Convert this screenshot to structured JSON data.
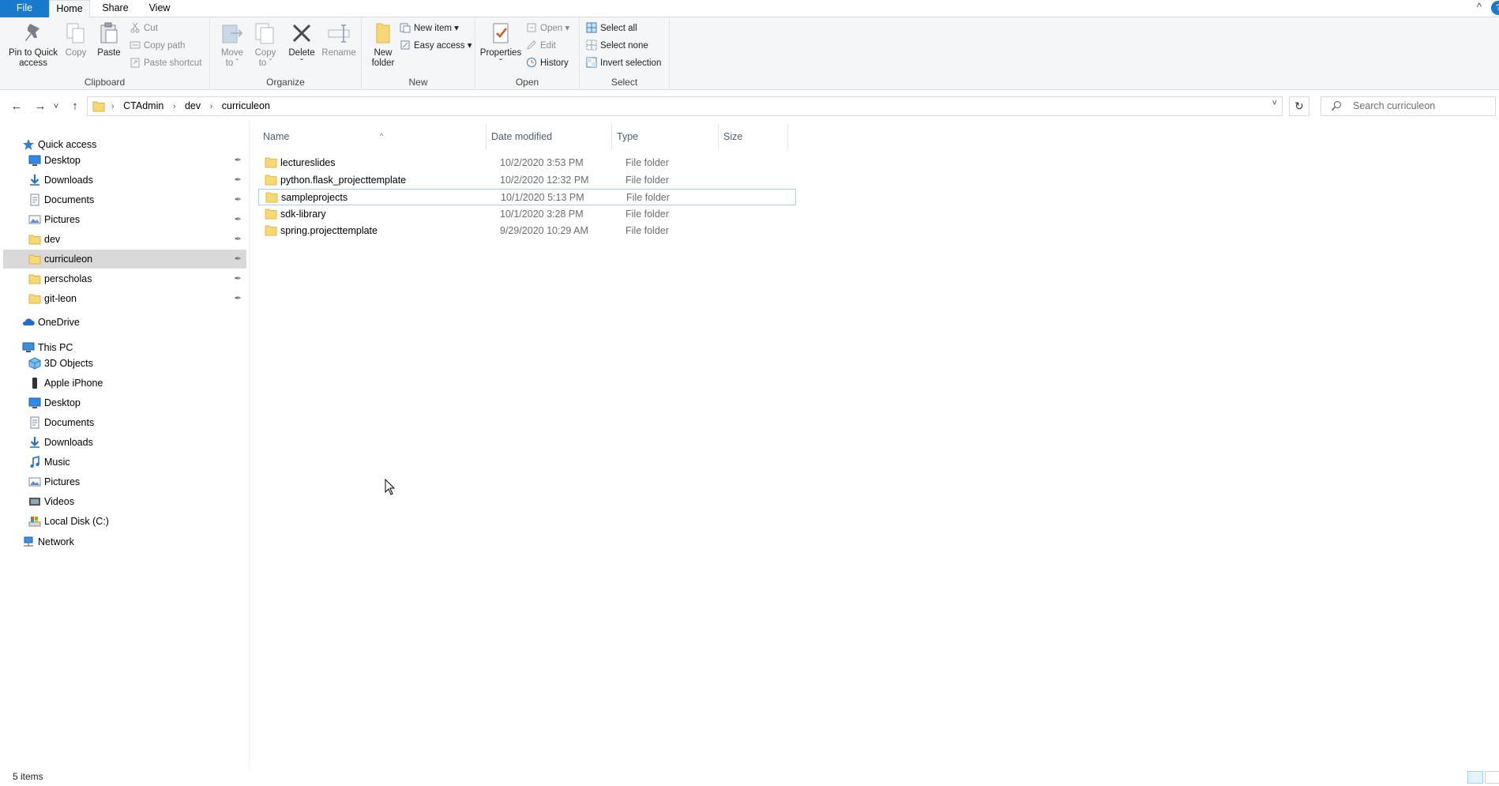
{
  "ribbon_tabs": {
    "file": "File",
    "home": "Home",
    "share": "Share",
    "view": "View"
  },
  "window": {
    "collapse_glyph": "^",
    "help_glyph": "?"
  },
  "ribbon": {
    "clipboard": {
      "label": "Clipboard",
      "pin_line1": "Pin to Quick",
      "pin_line2": "access",
      "copy": "Copy",
      "paste": "Paste",
      "cut": "Cut",
      "copy_path": "Copy path",
      "paste_shortcut": "Paste shortcut"
    },
    "organize": {
      "label": "Organize",
      "move_line1": "Move",
      "move_line2": "to ˇ",
      "copyto_line1": "Copy",
      "copyto_line2": "to ˇ",
      "delete": "Delete",
      "delete_arrow": "ˇ",
      "rename": "Rename"
    },
    "new": {
      "label": "New",
      "folder_line1": "New",
      "folder_line2": "folder",
      "new_item": "New item ▾",
      "easy_access": "Easy access ▾"
    },
    "open": {
      "label": "Open",
      "properties": "Properties",
      "properties_arrow": "ˇ",
      "open": "Open ▾",
      "edit": "Edit",
      "history": "History"
    },
    "select": {
      "label": "Select",
      "select_all": "Select all",
      "select_none": "Select none",
      "invert": "Invert selection"
    }
  },
  "address": {
    "back": "←",
    "forward": "→",
    "recent": "˅",
    "up": "↑",
    "crumbs": [
      "CTAdmin",
      "dev",
      "curriculeon"
    ],
    "sep": "›",
    "dropdown": "˅",
    "refresh": "↻",
    "search_placeholder": "Search curriculeon"
  },
  "nav": {
    "quick_access": "Quick access",
    "qa_items": [
      {
        "label": "Desktop",
        "icon": "desktop-icon"
      },
      {
        "label": "Downloads",
        "icon": "downloads-icon"
      },
      {
        "label": "Documents",
        "icon": "documents-icon"
      },
      {
        "label": "Pictures",
        "icon": "pictures-icon"
      },
      {
        "label": "dev",
        "icon": "folder-icon"
      },
      {
        "label": "curriculeon",
        "icon": "folder-icon"
      },
      {
        "label": "perscholas",
        "icon": "folder-icon"
      },
      {
        "label": "git-leon",
        "icon": "folder-icon"
      }
    ],
    "onedrive": "OneDrive",
    "this_pc": "This PC",
    "pc_items": [
      {
        "label": "3D Objects",
        "icon": "3d-objects-icon"
      },
      {
        "label": "Apple iPhone",
        "icon": "phone-icon"
      },
      {
        "label": "Desktop",
        "icon": "desktop-icon"
      },
      {
        "label": "Documents",
        "icon": "documents-icon"
      },
      {
        "label": "Downloads",
        "icon": "downloads-icon"
      },
      {
        "label": "Music",
        "icon": "music-icon"
      },
      {
        "label": "Pictures",
        "icon": "pictures-icon"
      },
      {
        "label": "Videos",
        "icon": "videos-icon"
      },
      {
        "label": "Local Disk (C:)",
        "icon": "drive-icon"
      }
    ],
    "network": "Network",
    "pin_glyph": "📌"
  },
  "columns": {
    "name": "Name",
    "date": "Date modified",
    "type": "Type",
    "size": "Size",
    "sort_glyph": "^"
  },
  "files": [
    {
      "name": "lectureslides",
      "date": "10/2/2020 3:53 PM",
      "type": "File folder"
    },
    {
      "name": "python.flask_projecttemplate",
      "date": "10/2/2020 12:32 PM",
      "type": "File folder"
    },
    {
      "name": "sampleprojects",
      "date": "10/1/2020 5:13 PM",
      "type": "File folder"
    },
    {
      "name": "sdk-library",
      "date": "10/1/2020 3:28 PM",
      "type": "File folder"
    },
    {
      "name": "spring.projecttemplate",
      "date": "9/29/2020 10:29 AM",
      "type": "File folder"
    }
  ],
  "status": {
    "count": "5 items"
  },
  "colors": {
    "accent": "#1979ca",
    "folder": "#f8d775",
    "folder_dark": "#e8b93f",
    "selection": "#cce8ff"
  }
}
